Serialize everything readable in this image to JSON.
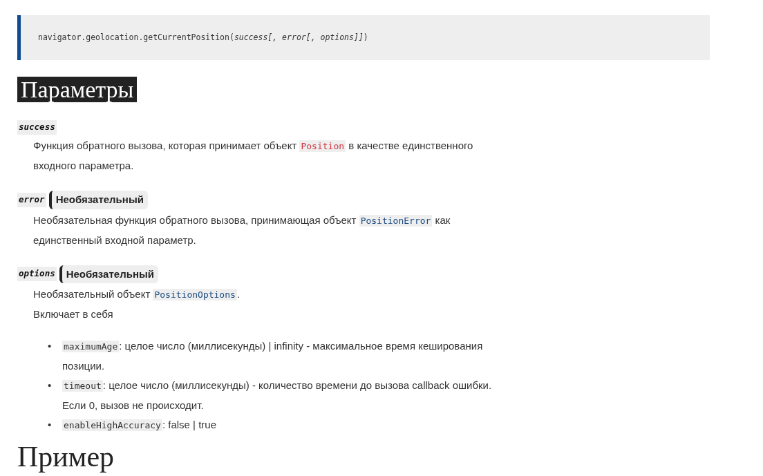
{
  "syntax": "navigator.geolocation.getCurrentPosition(*success[, error[, options]]*)",
  "heading": "Параметры",
  "parameters": [
    {
      "name": "success",
      "paragraphs": [
        [
          {
            "kind": "text",
            "text": "Функция обратного вызова, которая принимает объект "
          },
          {
            "kind": "missing-link",
            "text": "Position"
          },
          {
            "kind": "text",
            "text": " в качестве единственного входного параметра."
          }
        ]
      ]
    },
    {
      "name": "error",
      "badge": "Необязательный",
      "paragraphs": [
        [
          {
            "kind": "text",
            "text": "Необязательная функция обратного вызова, принимающая объект "
          },
          {
            "kind": "link",
            "text": "PositionError"
          },
          {
            "kind": "text",
            "text": " как единственный входной параметр."
          }
        ]
      ]
    },
    {
      "name": "options",
      "badge": "Необязательный",
      "paragraphs": [
        [
          {
            "kind": "text",
            "text": "Необязательный объект "
          },
          {
            "kind": "link",
            "text": "PositionOptions"
          },
          {
            "kind": "text",
            "text": "."
          }
        ],
        [
          {
            "kind": "text",
            "text": "Включает в себя"
          }
        ]
      ],
      "items": [
        {
          "marker": "•",
          "code": "maximumAge",
          "text": ": целое число (миллисекунды) | infinity - максимальное время кеширования позиции."
        },
        {
          "marker": "•",
          "code": "timeout",
          "text": ": целое число (миллисекунды) - количество времени до вызова callback ошибки. Если 0, вызов не происходит."
        },
        {
          "marker": "•",
          "code": "enableHighAccuracy",
          "text": ": false | true"
        }
      ]
    }
  ],
  "next_heading": "Пример"
}
